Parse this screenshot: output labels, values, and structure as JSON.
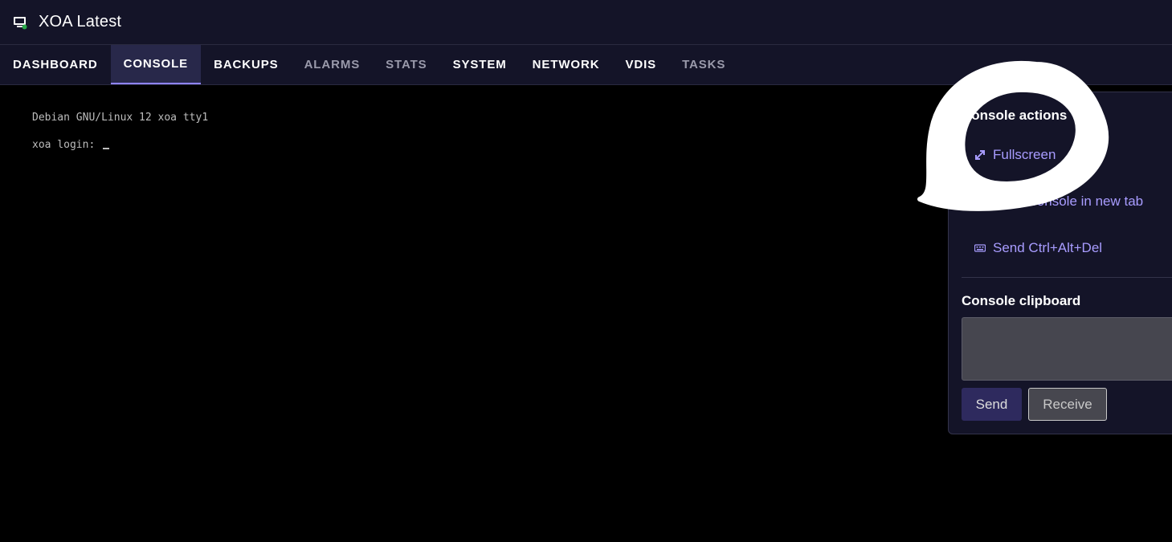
{
  "header": {
    "title": "XOA Latest",
    "icon": "vm-monitor-icon"
  },
  "tabs": [
    {
      "label": "DASHBOARD",
      "state": "normal"
    },
    {
      "label": "CONSOLE",
      "state": "active"
    },
    {
      "label": "BACKUPS",
      "state": "normal"
    },
    {
      "label": "ALARMS",
      "state": "muted"
    },
    {
      "label": "STATS",
      "state": "muted"
    },
    {
      "label": "SYSTEM",
      "state": "normal"
    },
    {
      "label": "NETWORK",
      "state": "normal"
    },
    {
      "label": "VDIS",
      "state": "normal"
    },
    {
      "label": "TASKS",
      "state": "muted"
    }
  ],
  "console": {
    "line1": "Debian GNU/Linux 12 xoa tty1",
    "line2": "xoa login: "
  },
  "panel": {
    "actions_heading": "Console actions",
    "fullscreen_label": "Fullscreen",
    "open_new_tab_label": "Open console in new tab",
    "ctrl_alt_del_label": "Send Ctrl+Alt+Del",
    "clipboard_heading": "Console clipboard",
    "clipboard_value": "",
    "send_label": "Send",
    "receive_label": "Receive"
  },
  "colors": {
    "accent": "#a89cff",
    "active_tab_border": "#8f84ff",
    "header_bg": "#141428",
    "console_bg": "#000000"
  }
}
